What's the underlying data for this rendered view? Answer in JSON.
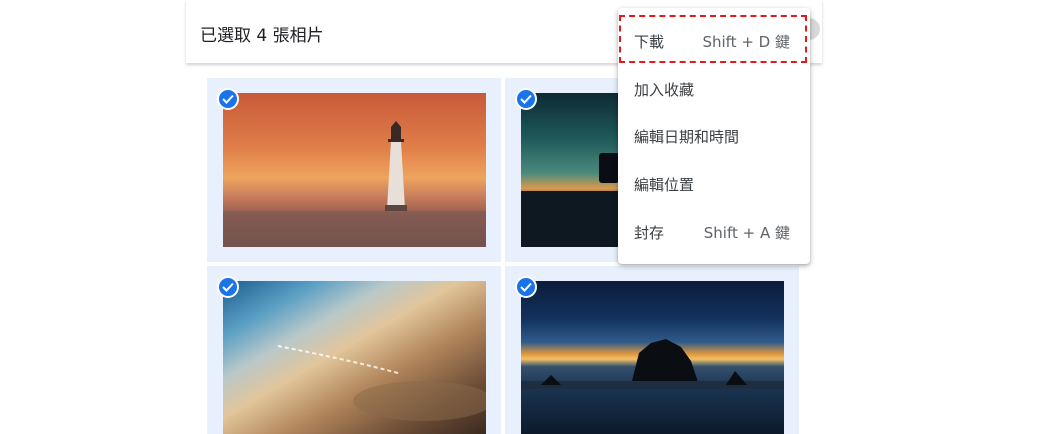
{
  "header": {
    "title": "已選取 4 張相片"
  },
  "photos": [
    {
      "alt": "lighthouse-sunset",
      "selected": true
    },
    {
      "alt": "coast-night",
      "selected": true
    },
    {
      "alt": "clouds-aerial",
      "selected": true
    },
    {
      "alt": "sea-stack-sunset",
      "selected": true
    }
  ],
  "menu": {
    "items": [
      {
        "label": "下載",
        "shortcut": "Shift + D 鍵"
      },
      {
        "label": "加入收藏",
        "shortcut": ""
      },
      {
        "label": "編輯日期和時間",
        "shortcut": ""
      },
      {
        "label": "編輯位置",
        "shortcut": ""
      },
      {
        "label": "封存",
        "shortcut": "Shift + A 鍵"
      }
    ]
  },
  "colors": {
    "accent": "#1a73e8",
    "tile_bg": "#e8f0fe",
    "highlight": "#e01b1b"
  }
}
